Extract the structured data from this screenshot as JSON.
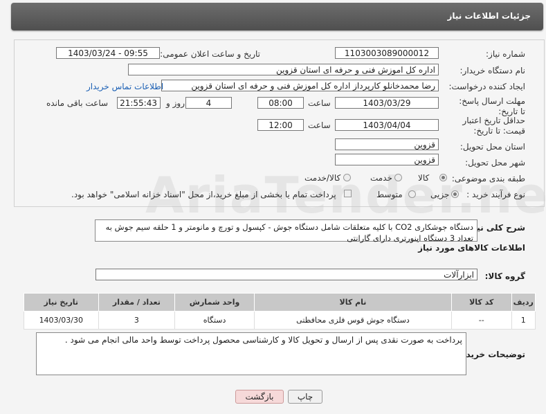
{
  "header": {
    "title": "جزئیات اطلاعات نیاز"
  },
  "form": {
    "need_number_label": "شماره نیاز:",
    "need_number": "1103003089000012",
    "announce_label": "تاریخ و ساعت اعلان عمومی:",
    "announce_value": "1403/03/24 - 09:55",
    "buyer_label": "نام دستگاه خریدار:",
    "buyer_value": "اداره کل اموزش فنی و حرفه ای استان قزوین",
    "creator_label": "ایجاد کننده درخواست:",
    "creator_value": "رضا محمدخانلو کارپرداز اداره کل اموزش فنی و حرفه ای استان قزوین",
    "contact_link": "اطلاعات تماس خریدار",
    "deadline_label": "مهلت ارسال پاسخ: تا تاریخ:",
    "deadline_date": "1403/03/29",
    "time_label": "ساعت",
    "deadline_time": "08:00",
    "days_value": "4",
    "days_label": "روز و",
    "remaining_time": "21:55:43",
    "remaining_label": "ساعت باقی مانده",
    "validity_label": "حداقل تاریخ اعتبار قیمت: تا تاریخ:",
    "validity_date": "1403/04/04",
    "validity_time": "12:00",
    "province_label": "استان محل تحویل:",
    "province_value": "قزوین",
    "city_label": "شهر محل تحویل:",
    "city_value": "قزوین",
    "category_label": "طبقه بندی موضوعی:",
    "category_options": [
      "کالا",
      "خدمت",
      "کالا/خدمت"
    ],
    "process_label": "نوع فرآیند خرید :",
    "process_options": [
      "جزیی",
      "متوسط"
    ],
    "payment_note": "پرداخت تمام یا بخشی از مبلغ خرید،از محل \"اسناد خزانه اسلامی\" خواهد بود."
  },
  "description": {
    "label": "شرح کلی نیاز:",
    "text": "دستگاه جوشکاری CO2 با کلیه متعلقات شامل دستگاه جوش - کپسول و تورچ و مانومتر و 1 حلقه سیم جوش به تعداد 3 دستگاه اینورتری دارای گارانتی"
  },
  "goods": {
    "section_title": "اطلاعات کالاهای مورد نیاز",
    "group_label": "گروه کالا:",
    "group_value": "ابزارآلات",
    "columns": [
      "ردیف",
      "کد کالا",
      "نام کالا",
      "واحد شمارش",
      "تعداد / مقدار",
      "تاریخ نیاز"
    ],
    "rows": [
      {
        "row": "1",
        "code": "--",
        "name": "دستگاه جوش قوس فلزی محافظتی",
        "unit": "دستگاه",
        "qty": "3",
        "date": "1403/03/30"
      }
    ]
  },
  "buyer_notes": {
    "label": "توضیحات خریدار:",
    "text": "پرداخت به صورت نقدی پس از ارسال و تحویل کالا و  کارشناسی محصول پرداخت توسط واحد مالی انجام می شود ."
  },
  "buttons": {
    "print": "چاپ",
    "back": "بازگشت"
  },
  "watermark": "AriaTender.net",
  "colors": {
    "header": "#5c5c5c",
    "link": "#1a5fb4",
    "back_button": "#f6d9d9"
  }
}
